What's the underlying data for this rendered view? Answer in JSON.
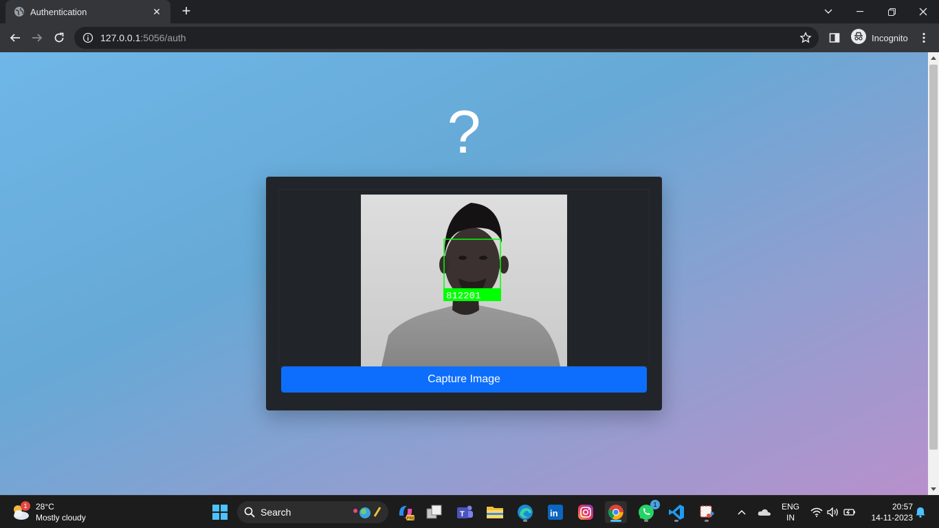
{
  "browser": {
    "tab_title": "Authentication",
    "url_host": "127.0.0.1",
    "url_rest": ":5056/auth",
    "profile_label": "Incognito"
  },
  "page": {
    "heading": "?",
    "face_label": "812201",
    "capture_button_label": "Capture Image",
    "colors": {
      "button": "#0d6efd",
      "card": "#212529",
      "face_box": "#00ff00"
    }
  },
  "taskbar": {
    "weather_temp": "28°C",
    "weather_desc": "Mostly cloudy",
    "weather_badge": "1",
    "search_label": "Search",
    "whatsapp_badge": "1",
    "lang_top": "ENG",
    "lang_bottom": "IN",
    "time": "20:57",
    "date": "14-11-2023",
    "pinned_icons": [
      "windows-start-icon",
      "copilot-icon",
      "task-view-icon",
      "teams-icon",
      "file-explorer-icon",
      "edge-icon",
      "linkedin-icon",
      "instagram-icon",
      "chrome-icon",
      "whatsapp-icon",
      "vscode-icon",
      "snipping-tool-icon"
    ]
  }
}
